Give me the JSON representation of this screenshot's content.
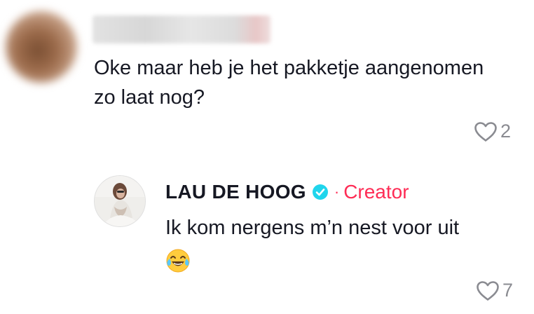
{
  "first_comment": {
    "text": "Oke maar heb je het pakketje aangenomen zo laat nog?",
    "likes": "2"
  },
  "reply": {
    "author": "LAU DE HOOG",
    "separator": "·",
    "badge_label": "Creator",
    "text": "Ik kom nergens m’n nest voor uit",
    "emoji": "face-with-tears-of-joy",
    "likes": "7"
  },
  "colors": {
    "text": "#161823",
    "muted": "#8a8b91",
    "creator_accent": "#fe2c55",
    "verified": "#20d5ec"
  }
}
